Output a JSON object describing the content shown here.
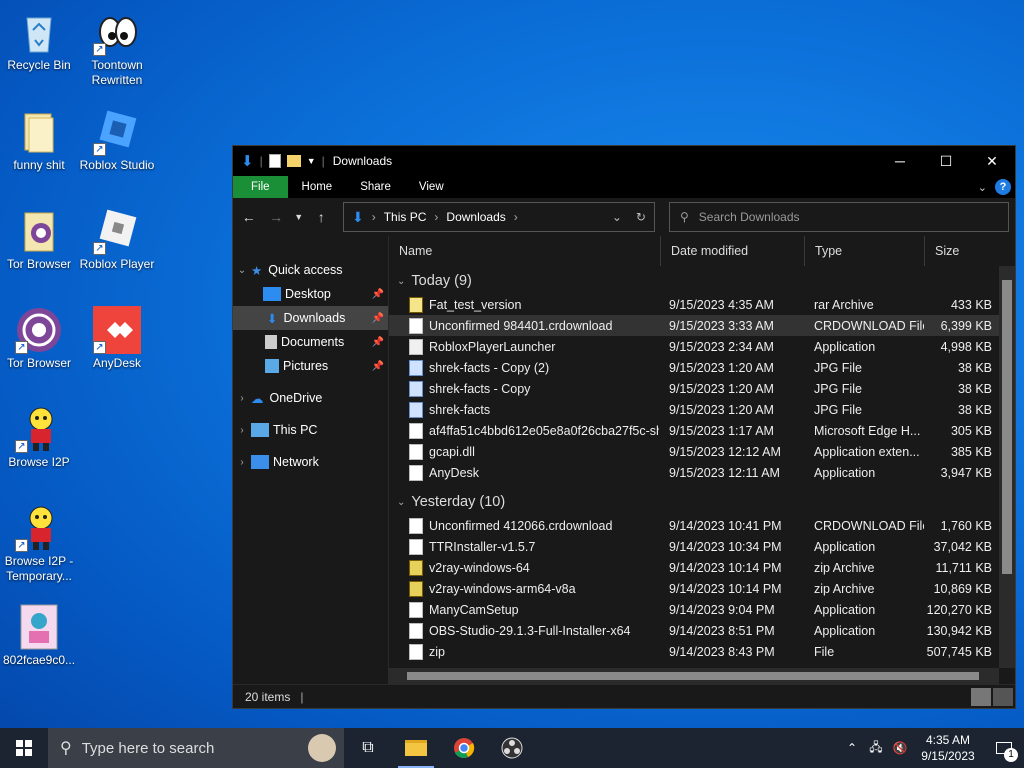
{
  "desktop": {
    "icons": [
      {
        "label": "Recycle Bin",
        "icon": "recycle-bin-icon"
      },
      {
        "label": "Toontown Rewritten",
        "icon": "toontown-icon"
      },
      {
        "label": "funny shit",
        "icon": "folder-icon"
      },
      {
        "label": "Roblox Studio",
        "icon": "roblox-studio-icon"
      },
      {
        "label": "Tor Browser",
        "icon": "tor-folder-icon"
      },
      {
        "label": "Roblox Player",
        "icon": "roblox-player-icon"
      },
      {
        "label": "Tor Browser",
        "icon": "tor-browser-icon"
      },
      {
        "label": "AnyDesk",
        "icon": "anydesk-icon"
      },
      {
        "label": "Browse I2P",
        "icon": "i2p-icon"
      },
      {
        "label": "Browse I2P - Temporary...",
        "icon": "i2p-icon"
      },
      {
        "label": "802fcae9c0...",
        "icon": "image-file-icon"
      }
    ]
  },
  "explorer": {
    "title": "Downloads",
    "ribbon_tabs": [
      "File",
      "Home",
      "Share",
      "View"
    ],
    "breadcrumb": [
      "This PC",
      "Downloads"
    ],
    "search_placeholder": "Search Downloads",
    "nav": {
      "quick_access": "Quick access",
      "items": [
        "Desktop",
        "Downloads",
        "Documents",
        "Pictures"
      ],
      "onedrive": "OneDrive",
      "thispc": "This PC",
      "network": "Network"
    },
    "columns": {
      "name": "Name",
      "date": "Date modified",
      "type": "Type",
      "size": "Size"
    },
    "groups": [
      {
        "label": "Today (9)",
        "rows": [
          {
            "name": "Fat_test_version",
            "date": "9/15/2023 4:35 AM",
            "type": "rar Archive",
            "size": "433 KB",
            "icon": "rar"
          },
          {
            "name": "Unconfirmed 984401.crdownload",
            "date": "9/15/2023 3:33 AM",
            "type": "CRDOWNLOAD File",
            "size": "6,399 KB",
            "icon": "file"
          },
          {
            "name": "RobloxPlayerLauncher",
            "date": "9/15/2023 2:34 AM",
            "type": "Application",
            "size": "4,998 KB",
            "icon": "app"
          },
          {
            "name": "shrek-facts - Copy (2)",
            "date": "9/15/2023 1:20 AM",
            "type": "JPG File",
            "size": "38 KB",
            "icon": "jpg"
          },
          {
            "name": "shrek-facts - Copy",
            "date": "9/15/2023 1:20 AM",
            "type": "JPG File",
            "size": "38 KB",
            "icon": "jpg"
          },
          {
            "name": "shrek-facts",
            "date": "9/15/2023 1:20 AM",
            "type": "JPG File",
            "size": "38 KB",
            "icon": "jpg"
          },
          {
            "name": "af4ffa51c4bbd612e05e8a0f26cba27f5c-sh...",
            "date": "9/15/2023 1:17 AM",
            "type": "Microsoft Edge H...",
            "size": "305 KB",
            "icon": "file"
          },
          {
            "name": "gcapi.dll",
            "date": "9/15/2023 12:12 AM",
            "type": "Application exten...",
            "size": "385 KB",
            "icon": "file"
          },
          {
            "name": "AnyDesk",
            "date": "9/15/2023 12:11 AM",
            "type": "Application",
            "size": "3,947 KB",
            "icon": "file"
          }
        ]
      },
      {
        "label": "Yesterday (10)",
        "rows": [
          {
            "name": "Unconfirmed 412066.crdownload",
            "date": "9/14/2023 10:41 PM",
            "type": "CRDOWNLOAD File",
            "size": "1,760 KB",
            "icon": "file"
          },
          {
            "name": "TTRInstaller-v1.5.7",
            "date": "9/14/2023 10:34 PM",
            "type": "Application",
            "size": "37,042 KB",
            "icon": "file"
          },
          {
            "name": "v2ray-windows-64",
            "date": "9/14/2023 10:14 PM",
            "type": "zip Archive",
            "size": "11,711 KB",
            "icon": "zip"
          },
          {
            "name": "v2ray-windows-arm64-v8a",
            "date": "9/14/2023 10:14 PM",
            "type": "zip Archive",
            "size": "10,869 KB",
            "icon": "zip"
          },
          {
            "name": "ManyCamSetup",
            "date": "9/14/2023 9:04 PM",
            "type": "Application",
            "size": "120,270 KB",
            "icon": "file"
          },
          {
            "name": "OBS-Studio-29.1.3-Full-Installer-x64",
            "date": "9/14/2023 8:51 PM",
            "type": "Application",
            "size": "130,942 KB",
            "icon": "file"
          },
          {
            "name": "zip",
            "date": "9/14/2023 8:43 PM",
            "type": "File",
            "size": "507,745 KB",
            "icon": "file"
          }
        ]
      }
    ],
    "status": "20 items"
  },
  "taskbar": {
    "search_placeholder": "Type here to search",
    "time": "4:35 AM",
    "date": "9/15/2023",
    "notifications": "1"
  }
}
